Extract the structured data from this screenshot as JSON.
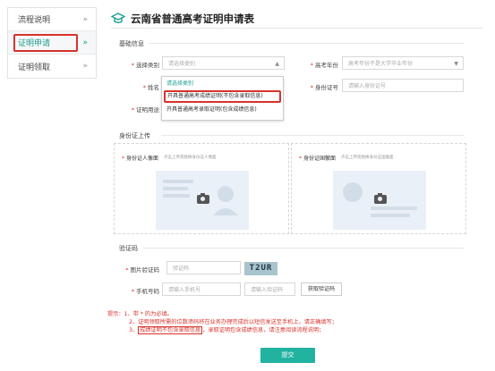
{
  "sidebar": {
    "items": [
      {
        "label": "流程说明",
        "chevron": "»"
      },
      {
        "label": "证明申请",
        "chevron": "»"
      },
      {
        "label": "证明领取",
        "chevron": "»"
      }
    ]
  },
  "header": {
    "title": "云南省普通高考证明申请表",
    "icon": "mortarboard-icon"
  },
  "basic": {
    "section_title": "基础信息",
    "type_label": "选择类别",
    "type_placeholder": "请选择类别",
    "year_label": "高考年份",
    "year_value": "高考年份不是大学毕业年份",
    "name_label": "姓名",
    "id_label": "身份证号",
    "id_placeholder": "请输入身份证号",
    "purpose_label": "证明用途"
  },
  "dropdown": {
    "options": [
      "请选择类别",
      "开具普通高考成绩证明(不包含录取信息)",
      "开具普通高考录取证明(包含成绩信息)"
    ]
  },
  "idcard": {
    "section_title": "身份证上传",
    "front_label": "身份证人像面",
    "front_hint": "点击上传或替换身份证人像面",
    "back_label": "身份证国徽面",
    "back_hint": "点击上传或替换身份证国徽面"
  },
  "verify": {
    "section_title": "验证码",
    "captcha_label": "图片验证码",
    "captcha_placeholder": "验证码",
    "captcha_text": "T2UR",
    "phone_label": "手机号码",
    "phone_placeholder": "请输入手机号",
    "sms_placeholder": "请输入验证码",
    "get_code": "获取验证码"
  },
  "notes": {
    "prefix": "提示：",
    "line1": "1、带 * 的为必填。",
    "line2": "2、证明领取所需的位数须码将在业务办理完成后以短信发送至手机上，请正确填写；",
    "line3_num": "3、",
    "line3_hl": "成绩证明不包含录取信息",
    "line3_rest": "，录取证明包含成绩信息，请注意阅读流程说明；"
  },
  "submit_label": "提交",
  "colors": {
    "accent": "#21b3a0",
    "highlight": "#d9322c"
  }
}
